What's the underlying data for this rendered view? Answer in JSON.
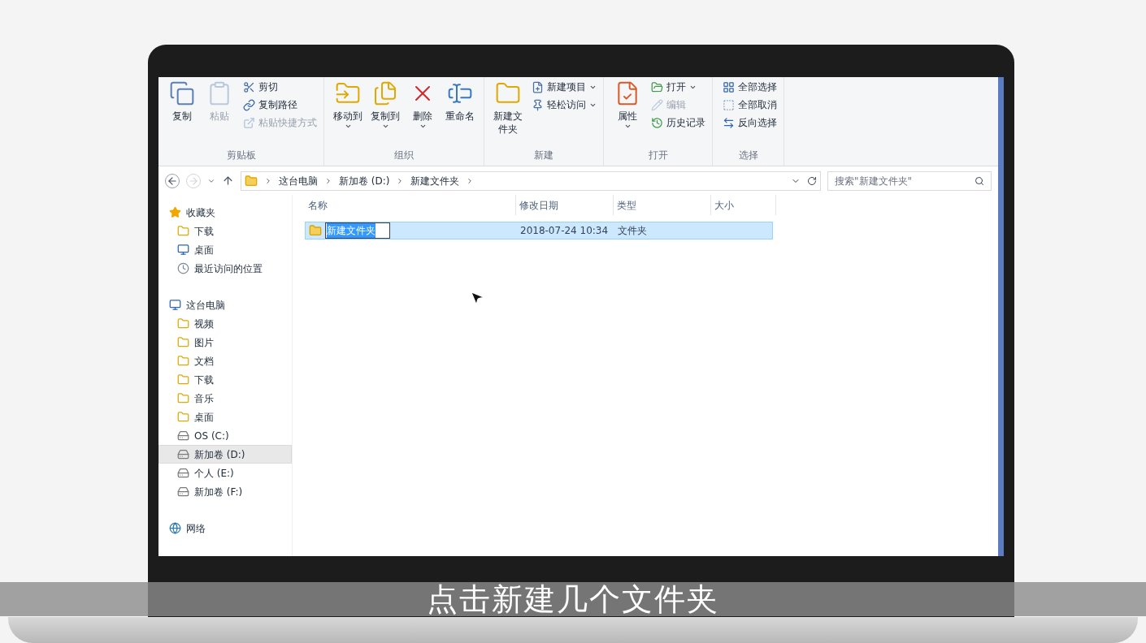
{
  "ribbon": {
    "groups": [
      {
        "label": "剪贴板",
        "buttons": [
          {
            "kind": "large",
            "label": "复制",
            "disabled": false,
            "dropdown": false
          },
          {
            "kind": "large",
            "label": "粘贴",
            "disabled": true,
            "dropdown": false
          },
          {
            "kind": "small",
            "label": "剪切",
            "disabled": false,
            "dropdown": false
          },
          {
            "kind": "small",
            "label": "复制路径",
            "disabled": false,
            "dropdown": false
          },
          {
            "kind": "small",
            "label": "粘贴快捷方式",
            "disabled": true,
            "dropdown": false
          }
        ]
      },
      {
        "label": "组织",
        "buttons": [
          {
            "kind": "large",
            "label": "移动到",
            "disabled": false,
            "dropdown": true
          },
          {
            "kind": "large",
            "label": "复制到",
            "disabled": false,
            "dropdown": true
          },
          {
            "kind": "large",
            "label": "删除",
            "disabled": false,
            "dropdown": true
          },
          {
            "kind": "large",
            "label": "重命名",
            "disabled": false,
            "dropdown": false
          }
        ]
      },
      {
        "label": "新建",
        "buttons": [
          {
            "kind": "large",
            "label": "新建文件夹",
            "disabled": false,
            "dropdown": false
          },
          {
            "kind": "small",
            "label": "新建项目",
            "disabled": false,
            "dropdown": true
          },
          {
            "kind": "small",
            "label": "轻松访问",
            "disabled": false,
            "dropdown": true
          }
        ]
      },
      {
        "label": "打开",
        "buttons": [
          {
            "kind": "large",
            "label": "属性",
            "disabled": false,
            "dropdown": true
          },
          {
            "kind": "small",
            "label": "打开",
            "disabled": false,
            "dropdown": true
          },
          {
            "kind": "small",
            "label": "编辑",
            "disabled": true,
            "dropdown": false
          },
          {
            "kind": "small",
            "label": "历史记录",
            "disabled": false,
            "dropdown": false
          }
        ]
      },
      {
        "label": "选择",
        "buttons": [
          {
            "kind": "small",
            "label": "全部选择",
            "disabled": false,
            "dropdown": false
          },
          {
            "kind": "small",
            "label": "全部取消",
            "disabled": false,
            "dropdown": false
          },
          {
            "kind": "small",
            "label": "反向选择",
            "disabled": false,
            "dropdown": false
          }
        ]
      }
    ]
  },
  "address": {
    "path": [
      "这台电脑",
      "新加卷 (D:)",
      "新建文件夹"
    ]
  },
  "search": {
    "placeholder": "搜索\"新建文件夹\""
  },
  "sidebar": {
    "items": [
      {
        "label": "收藏夹",
        "kind": "star",
        "selected": false,
        "children": [
          {
            "label": "下载",
            "kind": "folder",
            "selected": false
          },
          {
            "label": "桌面",
            "kind": "desktop",
            "selected": false
          },
          {
            "label": "最近访问的位置",
            "kind": "recent",
            "selected": false
          }
        ]
      },
      {
        "label": "这台电脑",
        "kind": "computer",
        "selected": false,
        "children": [
          {
            "label": "视频",
            "kind": "folder",
            "selected": false
          },
          {
            "label": "图片",
            "kind": "folder",
            "selected": false
          },
          {
            "label": "文档",
            "kind": "folder",
            "selected": false
          },
          {
            "label": "下载",
            "kind": "folder",
            "selected": false
          },
          {
            "label": "音乐",
            "kind": "folder",
            "selected": false
          },
          {
            "label": "桌面",
            "kind": "folder",
            "selected": false
          },
          {
            "label": "OS (C:)",
            "kind": "drive",
            "selected": false
          },
          {
            "label": "新加卷 (D:)",
            "kind": "drive",
            "selected": true
          },
          {
            "label": "个人 (E:)",
            "kind": "drive",
            "selected": false
          },
          {
            "label": "新加卷 (F:)",
            "kind": "drive",
            "selected": false
          }
        ]
      },
      {
        "label": "网络",
        "kind": "network",
        "selected": false
      }
    ]
  },
  "table": {
    "columns": [
      "名称",
      "修改日期",
      "类型",
      "大小"
    ],
    "rows": [
      {
        "name": "新建文件夹",
        "date": "2018-07-24 10:34",
        "type": "文件夹",
        "selected": true,
        "editing": true
      }
    ]
  },
  "caption": "点击新建几个文件夹"
}
